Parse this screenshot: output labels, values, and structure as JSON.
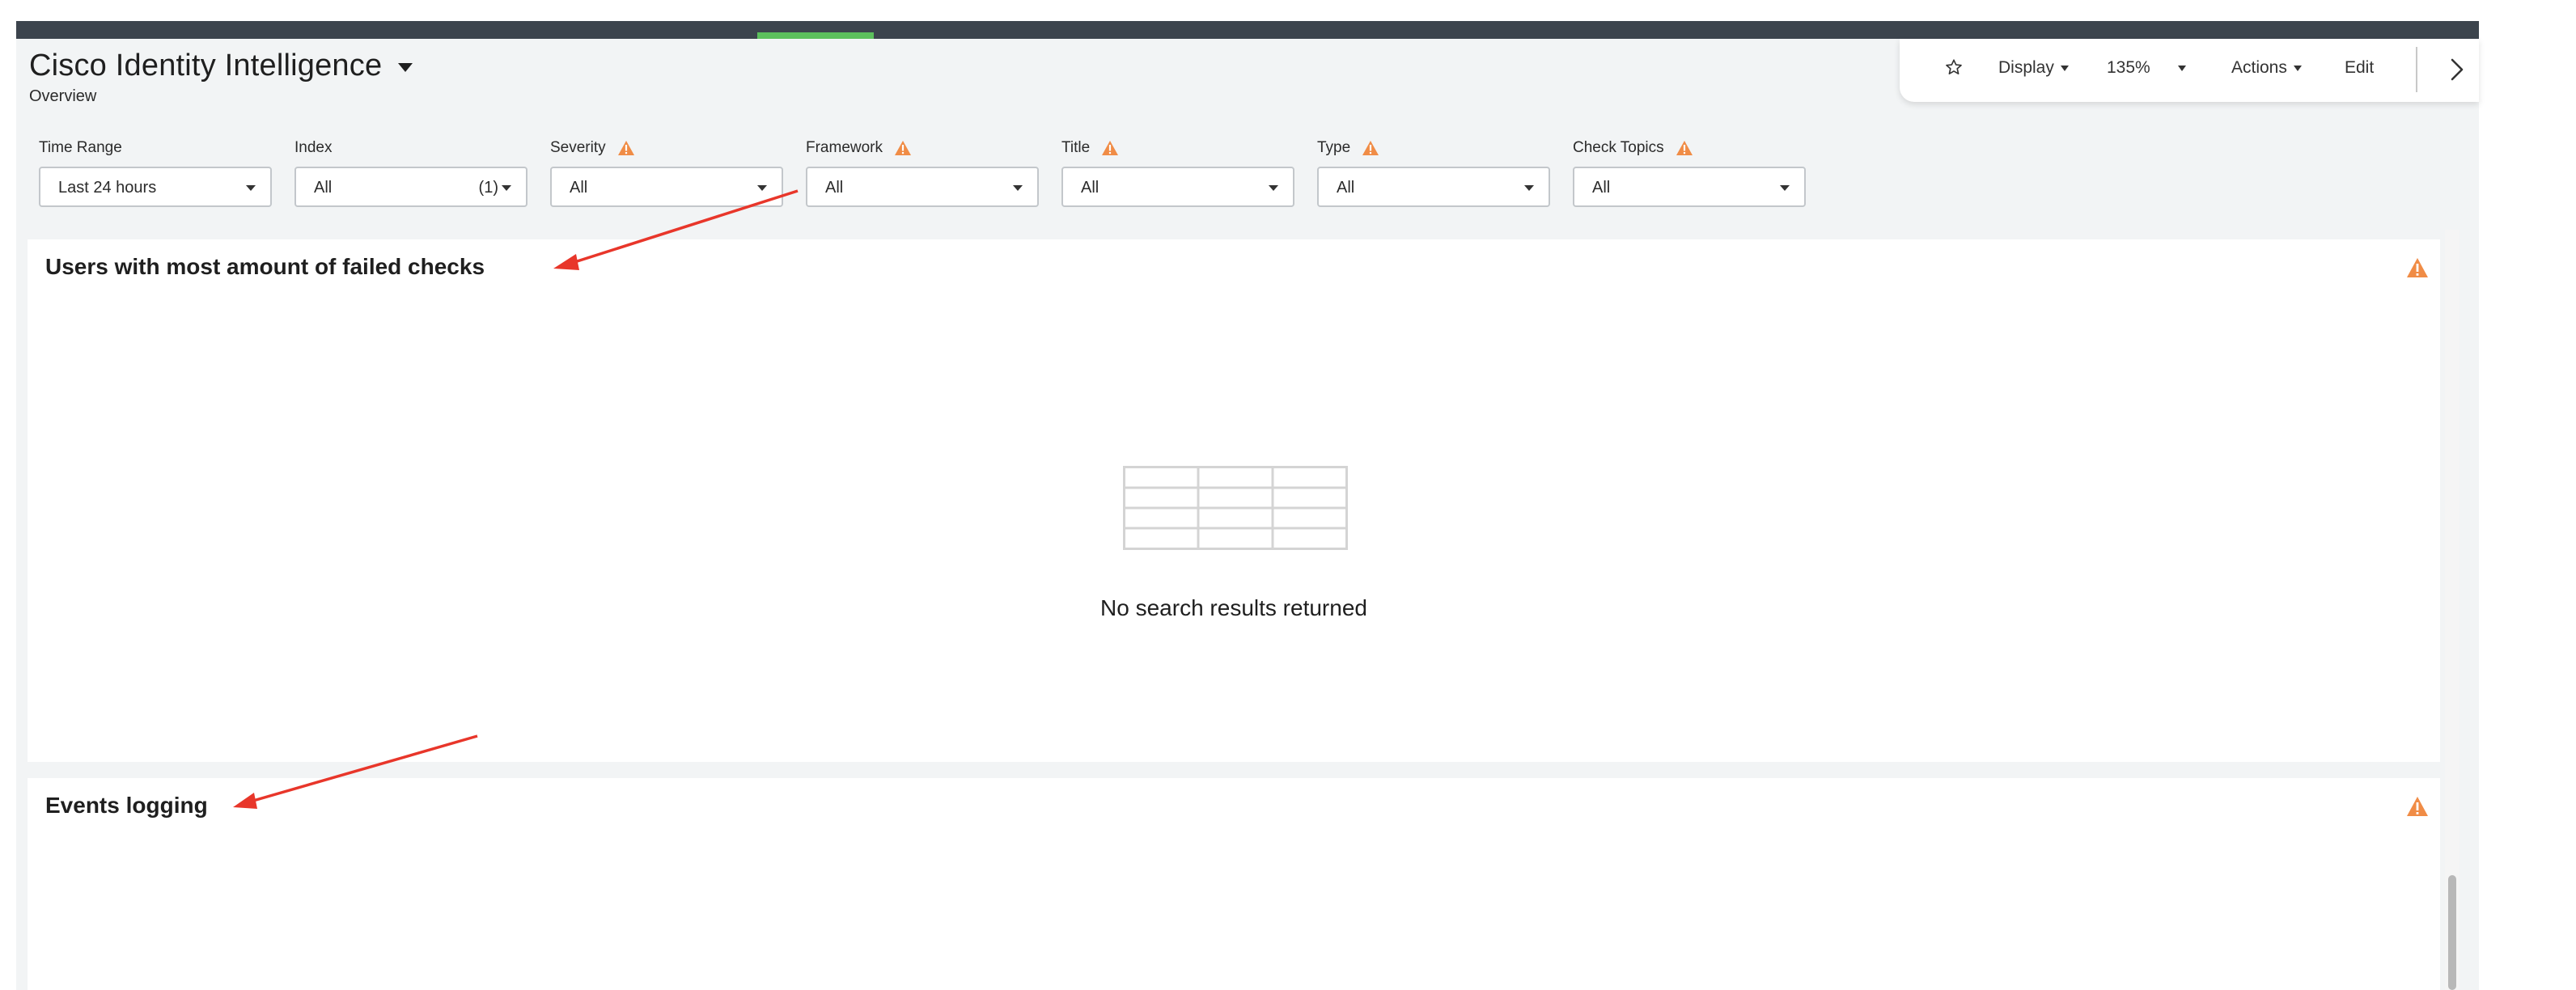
{
  "header": {
    "title": "Cisco Identity Intelligence",
    "subtitle": "Overview"
  },
  "toolbar": {
    "star_icon": "star-icon",
    "display_label": "Display",
    "zoom_label": "135%",
    "actions_label": "Actions",
    "edit_label": "Edit",
    "chevron_icon": "chevron-right-icon"
  },
  "filters": [
    {
      "label": "Time Range",
      "value": "Last 24 hours",
      "count": "",
      "warning": false
    },
    {
      "label": "Index",
      "value": "All",
      "count": "(1)",
      "warning": false
    },
    {
      "label": "Severity",
      "value": "All",
      "count": "",
      "warning": true
    },
    {
      "label": "Framework",
      "value": "All",
      "count": "",
      "warning": true
    },
    {
      "label": "Title",
      "value": "All",
      "count": "",
      "warning": true
    },
    {
      "label": "Type",
      "value": "All",
      "count": "",
      "warning": true
    },
    {
      "label": "Check Topics",
      "value": "All",
      "count": "",
      "warning": true
    }
  ],
  "panels": [
    {
      "title": "Users with most amount of failed checks",
      "empty_message": "No search results returned"
    },
    {
      "title": "Events logging"
    }
  ],
  "colors": {
    "topbar": "#3c444d",
    "accent_green": "#5cc05c",
    "warning_orange": "#f08c46",
    "annotation_red": "#e8362a"
  }
}
